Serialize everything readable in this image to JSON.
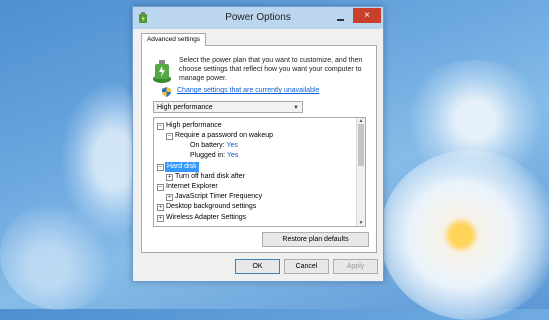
{
  "window": {
    "title": "Power Options",
    "close_label": "×",
    "icon": "power-options-icon"
  },
  "tab": {
    "label": "Advanced settings"
  },
  "intro": {
    "text": "Select the power plan that you want to customize, and then choose settings that reflect how you want your computer to manage power.",
    "link": "Change settings that are currently unavailable"
  },
  "plan_select": {
    "value": "High performance"
  },
  "tree": {
    "high_performance": "High performance",
    "require_password": "Require a password on wakeup",
    "on_battery_label": "On battery:",
    "on_battery_value": "Yes",
    "plugged_in_label": "Plugged in:",
    "plugged_in_value": "Yes",
    "hard_disk": "Hard disk",
    "turn_off_hard_disk": "Turn off hard disk after",
    "internet_explorer": "Internet Explorer",
    "js_timer": "JavaScript Timer Frequency",
    "desktop_background": "Desktop background settings",
    "wireless_adapter": "Wireless Adapter Settings"
  },
  "buttons": {
    "restore": "Restore plan defaults",
    "ok": "OK",
    "cancel": "Cancel",
    "apply": "Apply"
  },
  "colors": {
    "link": "#0b5ed7",
    "selection": "#3399ff",
    "close": "#c9402f"
  }
}
